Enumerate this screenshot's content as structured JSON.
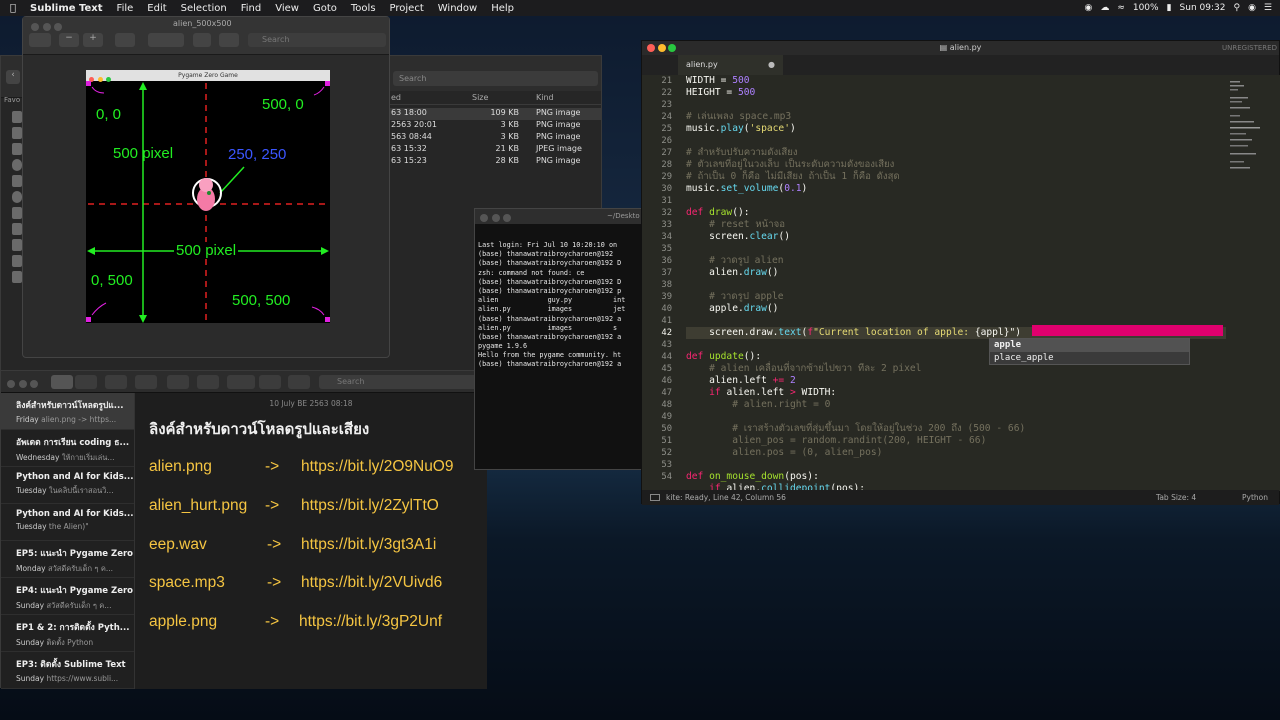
{
  "menubar": {
    "app": "Sublime Text",
    "items": [
      "File",
      "Edit",
      "Selection",
      "Find",
      "View",
      "Goto",
      "Tools",
      "Project",
      "Window",
      "Help"
    ],
    "battery": "100%",
    "clock": "Sun 09:32"
  },
  "finder": {
    "search_placeholder": "Search",
    "col_date": "ed",
    "col_size": "Size",
    "col_kind": "Kind",
    "rows": [
      {
        "date": "63 18:00",
        "size": "109 KB",
        "kind": "PNG image"
      },
      {
        "date": "2563 20:01",
        "size": "3 KB",
        "kind": "PNG image"
      },
      {
        "date": "563 08:44",
        "size": "3 KB",
        "kind": "PNG image"
      },
      {
        "date": "63 15:32",
        "size": "21 KB",
        "kind": "JPEG image"
      },
      {
        "date": "63 15:23",
        "size": "28 KB",
        "kind": "PNG image"
      }
    ],
    "sidebar_label": "Favo"
  },
  "preview": {
    "title": "alien_500x500",
    "search_placeholder": "Search",
    "game_title": "Pygame Zero Game",
    "labels": {
      "tl": "0, 0",
      "tr": "500, 0",
      "bl": "0, 500",
      "br": "500, 500",
      "center": "250, 250",
      "height": "500 pixel",
      "width": "500 pixel"
    }
  },
  "notes": {
    "date": "10 July BE 2563 08:18",
    "search_placeholder": "Search",
    "list": [
      {
        "title": "ลิงค์สำหรับดาวน์โหลดรูปแ...",
        "day": "Friday",
        "snippet": "alien.png -> https..."
      },
      {
        "title": "อัพเดต การเรียน coding ธ...",
        "day": "Wednesday",
        "snippet": "ให้กายเริ่มเล่น..."
      },
      {
        "title": "Python and AI for Kids...",
        "day": "Tuesday",
        "snippet": "ในคลิปนี้เราสอนวิ..."
      },
      {
        "title": "Python and AI for Kids...",
        "day": "Tuesday",
        "snippet": "the Alien)\""
      },
      {
        "title": "EP5: แนะนำ Pygame Zero",
        "day": "Monday",
        "snippet": "สวัสดีครับเด็ก ๆ ค..."
      },
      {
        "title": "EP4: แนะนำ Pygame Zero",
        "day": "Sunday",
        "snippet": "สวัสดีครับเด็ก ๆ ค..."
      },
      {
        "title": "EP1 & 2: การติดตั้ง Pyth...",
        "day": "Sunday",
        "snippet": "ติดตั้ง Python"
      },
      {
        "title": "EP3: ติดตั้ง Sublime Text",
        "day": "Sunday",
        "snippet": "https://www.subli..."
      }
    ],
    "heading": "ลิงค์สำหรับดาวน์โหลดรูปและเสียง",
    "rows": [
      {
        "file": "alien.png",
        "arrow": "->",
        "url": "https://bit.ly/2O9NuO9"
      },
      {
        "file": "alien_hurt.png",
        "arrow": "->",
        "url": "https://bit.ly/2ZylTtO"
      },
      {
        "file": "eep.wav",
        "arrow": "->",
        "url": "https://bit.ly/3gt3A1i"
      },
      {
        "file": "space.mp3",
        "arrow": "->",
        "url": "https://bit.ly/2VUivd6"
      },
      {
        "file": "apple.png",
        "arrow": "->",
        "url": "https://bit.ly/3gP2Unf"
      }
    ]
  },
  "terminal": {
    "title": "~/Deskto",
    "lines": [
      "Last login: Fri Jul 10 10:20:10 on",
      "(base) thanawatraibroycharoen@192",
      "(base) thanawatraibroycharoen@192 D",
      "zsh: command not found: ce",
      "(base) thanawatraibroycharoen@192 D",
      "(base) thanawatraibroycharoen@192 p",
      "alien            guy.py          int",
      "alien.py         images          jet",
      "(base) thanawatraibroycharoen@192 a",
      "alien.py         images          s",
      "(base) thanawatraibroycharoen@192 a",
      "pygame 1.9.6",
      "Hello from the pygame community. ht",
      "(base) thanawatraibroycharoen@192 a"
    ]
  },
  "sublime": {
    "title": "alien.py",
    "unregistered": "UNREGISTERED",
    "tab": "alien.py",
    "autocomplete": [
      "apple",
      "place_apple"
    ],
    "status_left": "Line 42, Column 56",
    "status_prefix": "kite: Ready, ",
    "tab_size": "Tab Size: 4",
    "syntax": "Python",
    "line_numbers": [
      "21",
      "22",
      "23",
      "24",
      "25",
      "26",
      "27",
      "28",
      "29",
      "30",
      "31",
      "32",
      "33",
      "34",
      "35",
      "36",
      "37",
      "38",
      "39",
      "40",
      "41",
      "42",
      "43",
      "44",
      "45",
      "46",
      "47",
      "48",
      "49",
      "50",
      "51",
      "52",
      "53",
      "54"
    ]
  }
}
